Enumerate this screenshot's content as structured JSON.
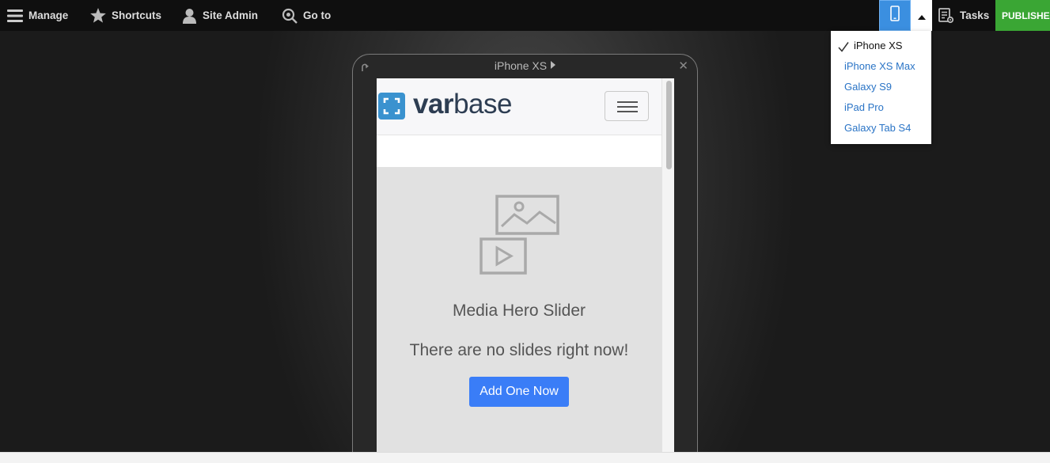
{
  "toolbar": {
    "manage": "Manage",
    "shortcuts": "Shortcuts",
    "site_admin": "Site Admin",
    "goto": "Go to",
    "tasks": "Tasks",
    "published": "PUBLISHED"
  },
  "responsive_preview": {
    "device_title": "iPhone XS",
    "devices": [
      {
        "label": "iPhone XS",
        "selected": true
      },
      {
        "label": "iPhone XS Max",
        "selected": false
      },
      {
        "label": "Galaxy S9",
        "selected": false
      },
      {
        "label": "iPad Pro",
        "selected": false
      },
      {
        "label": "Galaxy Tab S4",
        "selected": false
      }
    ]
  },
  "site": {
    "logo_bold": "var",
    "logo_light": "base",
    "hero_title": "Media Hero Slider",
    "hero_message": "There are no slides right now!",
    "add_button": "Add One Now"
  },
  "colors": {
    "toolbar_bg": "#0f0f0f",
    "accent_blue": "#3b8fe0",
    "published_green": "#3aa634",
    "link_blue": "#2a74c6",
    "button_blue": "#3a7df7"
  }
}
